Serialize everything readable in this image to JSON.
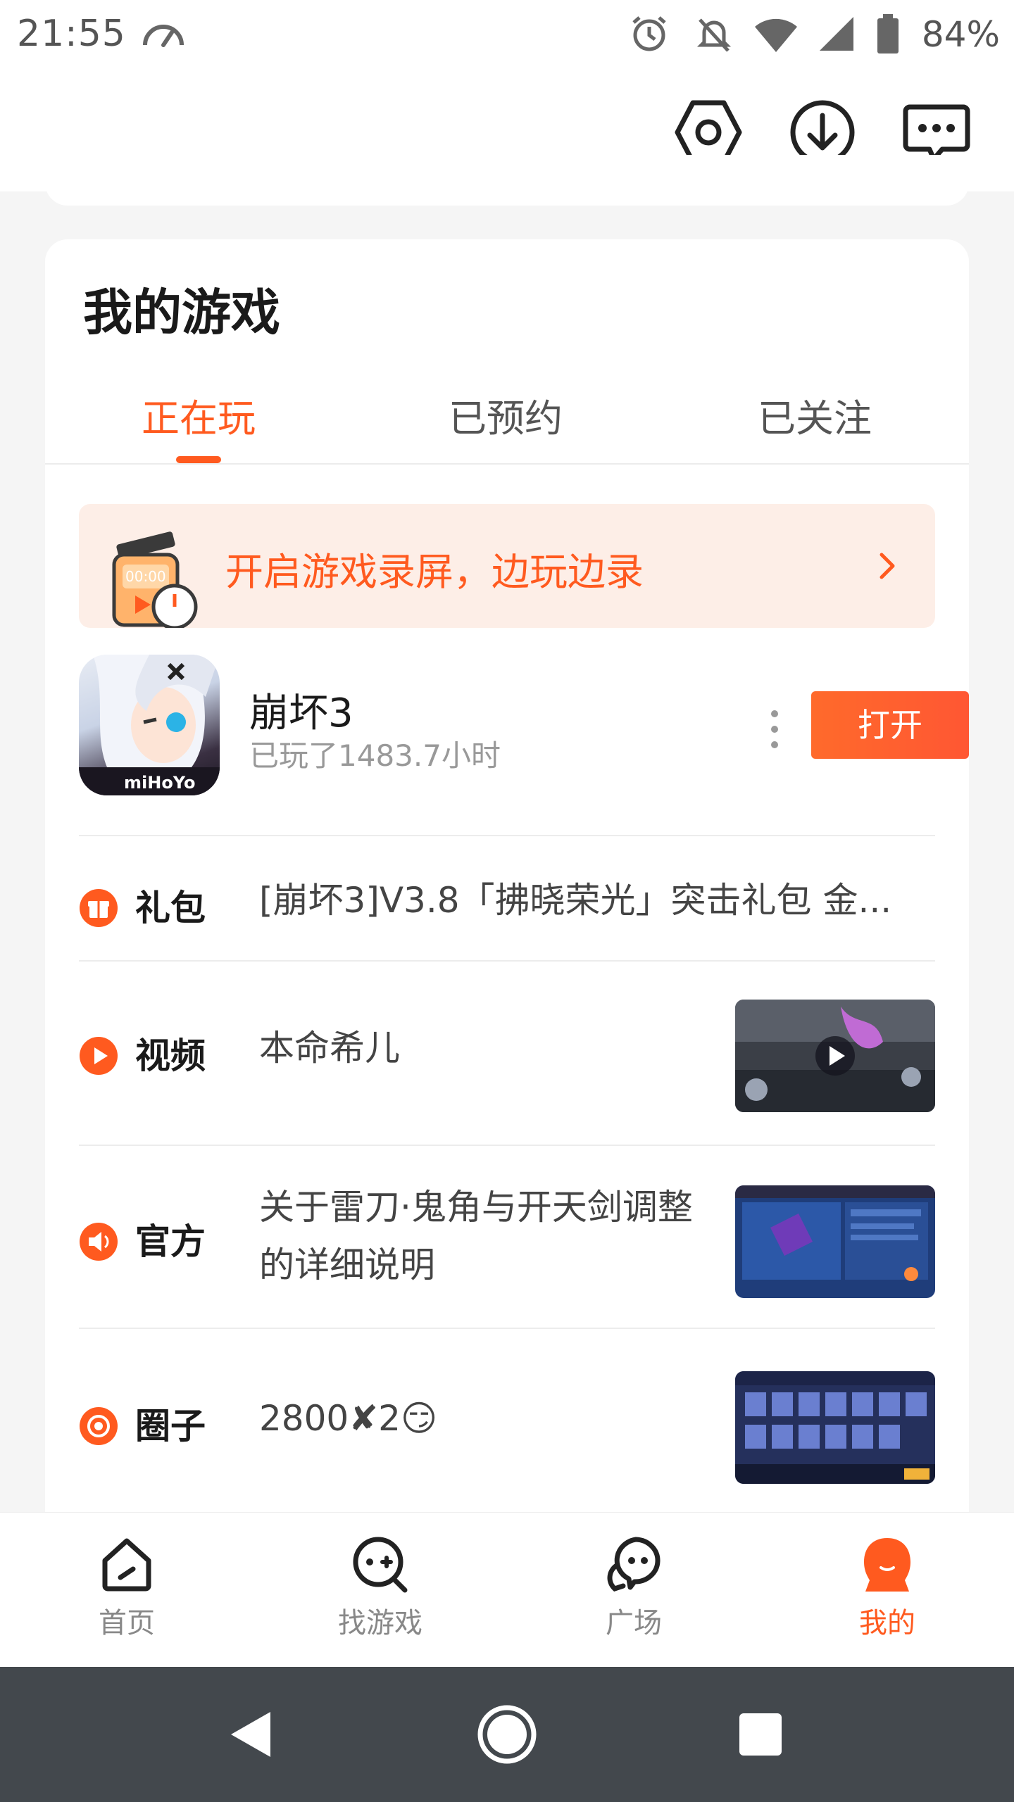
{
  "status_bar": {
    "time": "21:55",
    "battery": "84%"
  },
  "top_bar": {
    "icons": [
      "settings-icon",
      "download-icon",
      "message-icon"
    ]
  },
  "my_games": {
    "title": "我的游戏",
    "tabs": [
      {
        "label": "正在玩",
        "active": true
      },
      {
        "label": "已预约",
        "active": false
      },
      {
        "label": "已关注",
        "active": false
      }
    ],
    "banner": {
      "text": "开启游戏录屏，边玩边录",
      "illustration_text": "00:00"
    },
    "game": {
      "name": "崩坏3",
      "played": "已玩了1483.7小时",
      "open_label": "打开",
      "icon_brand": "miHoYo"
    },
    "features": [
      {
        "label": "礼包",
        "text": "[崩坏3]V3.8「拂晓荣光」突击礼包 金...",
        "icon": "gift-icon"
      },
      {
        "label": "视频",
        "text": "本命希儿",
        "icon": "play-icon"
      },
      {
        "label": "官方",
        "text": "关于雷刀·鬼角与开天剑调整的详细说明",
        "icon": "speaker-icon"
      },
      {
        "label": "圈子",
        "text": "2800✘2😏",
        "icon": "circle-icon"
      }
    ]
  },
  "bottom_nav": [
    {
      "label": "首页",
      "icon": "home-icon",
      "active": false
    },
    {
      "label": "找游戏",
      "icon": "find-game-icon",
      "active": false
    },
    {
      "label": "广场",
      "icon": "square-chat-icon",
      "active": false
    },
    {
      "label": "我的",
      "icon": "profile-icon",
      "active": true
    }
  ],
  "colors": {
    "accent": "#ff5a1f",
    "banner_bg": "#fdeee7",
    "system_nav": "#43484d"
  }
}
